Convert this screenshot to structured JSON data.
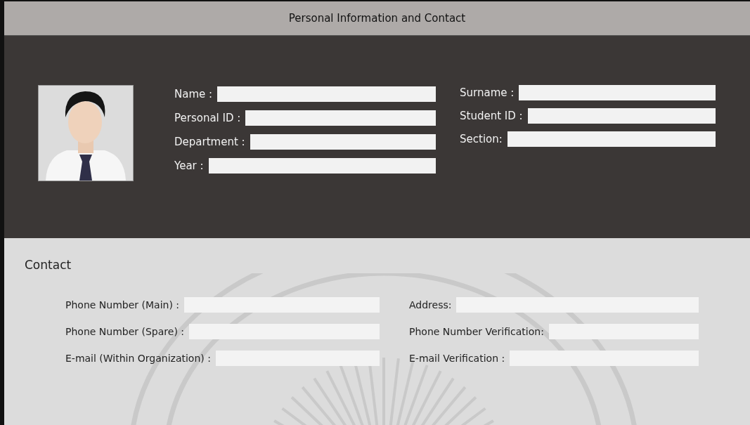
{
  "window": {
    "title": "Personal Information and Contact"
  },
  "profile": {
    "left_fields": [
      {
        "label": "Name :"
      },
      {
        "label": "Personal ID :"
      },
      {
        "label": "Department :"
      },
      {
        "label": "Year :"
      }
    ],
    "right_fields": [
      {
        "label": "Surname :"
      },
      {
        "label": "Student ID :"
      },
      {
        "label": "Section:"
      }
    ]
  },
  "contact": {
    "title": "Contact",
    "left_fields": [
      {
        "label": "Phone Number (Main) :"
      },
      {
        "label": "Phone Number (Spare) :"
      },
      {
        "label": "E-mail (Within Organization) :"
      }
    ],
    "right_fields": [
      {
        "label": "Address:"
      },
      {
        "label": "Phone Number Verification:"
      },
      {
        "label": "E-mail Verification :"
      }
    ]
  }
}
